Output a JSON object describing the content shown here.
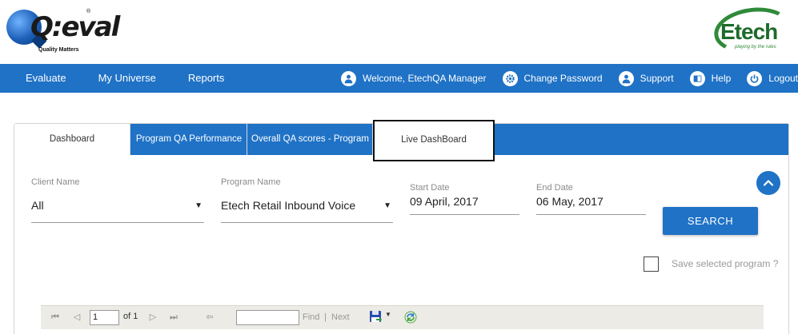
{
  "brand": {
    "left_logo_text": "Q:eval",
    "left_logo_tagline": "Quality Matters",
    "left_logo_mark": "®",
    "right_logo_text": "Etech",
    "right_logo_tagline": "playing by the rules"
  },
  "nav": {
    "left": [
      "Evaluate",
      "My Universe",
      "Reports"
    ],
    "welcome": "Welcome, EtechQA Manager",
    "change_password": "Change Password",
    "support": "Support",
    "help": "Help",
    "logout": "Logout"
  },
  "tabs": {
    "dashboard": "Dashboard",
    "program_qa": "Program QA Performance",
    "overall_qa": "Overall QA scores - Program",
    "live": "Live DashBoard"
  },
  "filters": {
    "client_label": "Client Name",
    "client_value": "All",
    "program_label": "Program Name",
    "program_value": "Etech Retail Inbound Voice",
    "start_label": "Start Date",
    "start_value": "09 April, 2017",
    "end_label": "End Date",
    "end_value": "06 May, 2017",
    "search_label": "SEARCH",
    "save_label": "Save selected program ?"
  },
  "toolbar": {
    "page_value": "1",
    "of_text": "of 1",
    "find_label": "Find",
    "separator": "|",
    "next_label": "Next"
  },
  "colors": {
    "primary": "#1f72c6",
    "toolbar_bg": "#ecebe5"
  }
}
